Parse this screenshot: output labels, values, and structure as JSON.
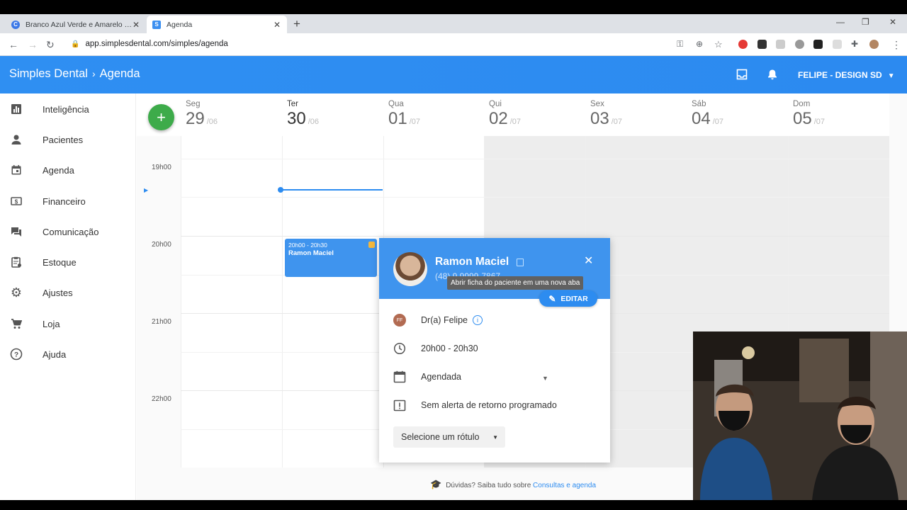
{
  "browser": {
    "tabs": [
      {
        "label": "Branco Azul Verde e Amarelo M…",
        "close": "✕",
        "favicon": "C"
      },
      {
        "label": "Agenda",
        "close": "✕",
        "favicon": "S"
      }
    ],
    "url": "app.simplesdental.com/simples/agenda"
  },
  "header": {
    "brand": "Simples Dental",
    "section": "Agenda",
    "user": "FELIPE - DESIGN SD"
  },
  "sidebar": {
    "items": [
      {
        "label": "Inteligência",
        "icon": "bar-chart-icon"
      },
      {
        "label": "Pacientes",
        "icon": "person-icon"
      },
      {
        "label": "Agenda",
        "icon": "calendar-icon"
      },
      {
        "label": "Financeiro",
        "icon": "money-icon"
      },
      {
        "label": "Comunicação",
        "icon": "chat-icon"
      },
      {
        "label": "Estoque",
        "icon": "clipboard-icon"
      },
      {
        "label": "Ajustes",
        "icon": "gear-icon"
      },
      {
        "label": "Loja",
        "icon": "cart-icon"
      },
      {
        "label": "Ajuda",
        "icon": "help-icon"
      }
    ]
  },
  "calendar": {
    "add_label": "+",
    "days": [
      {
        "name": "Seg",
        "num": "29",
        "month": "/06"
      },
      {
        "name": "Ter",
        "num": "30",
        "month": "/06"
      },
      {
        "name": "Qua",
        "num": "01",
        "month": "/07"
      },
      {
        "name": "Qui",
        "num": "02",
        "month": "/07"
      },
      {
        "name": "Sex",
        "num": "03",
        "month": "/07"
      },
      {
        "name": "Sáb",
        "num": "04",
        "month": "/07"
      },
      {
        "name": "Dom",
        "num": "05",
        "month": "/07"
      }
    ],
    "hours": [
      "19h00",
      "20h00",
      "21h00",
      "22h00"
    ],
    "appointment": {
      "time": "20h00 - 20h30",
      "patient": "Ramon Maciel"
    },
    "help_text": "Dúvidas? Saiba tudo sobre ",
    "help_link": "Consultas e agenda"
  },
  "popup": {
    "patient": "Ramon Maciel",
    "phone": "(48) 9 9999-7867",
    "tooltip": "Abrir ficha do paciente em uma nova aba",
    "edit_label": "EDITAR",
    "doctor_initials": "FF",
    "doctor": "Dr(a) Felipe",
    "time": "20h00 - 20h30",
    "status": "Agendada",
    "alert": "Sem alerta de retorno programado",
    "label_select": "Selecione um rótulo"
  }
}
